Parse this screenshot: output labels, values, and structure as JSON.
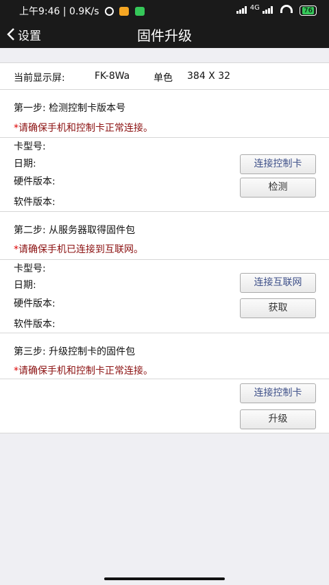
{
  "status_bar": {
    "time_speed": "上午9:46 | 0.9K/s",
    "network": "4G",
    "battery": "76"
  },
  "nav": {
    "back_label": "设置",
    "title": "固件升级"
  },
  "display": {
    "label": "当前显示屏:",
    "model": "FK-8Wa",
    "color_mode": "单色",
    "resolution": "384 X 32"
  },
  "step1": {
    "title": "第一步: 检测控制卡版本号",
    "notice_mark": "*",
    "notice": "请确保手机和控制卡正常连接。",
    "card_model": "卡型号:",
    "date": "日期:",
    "hw_version": "硬件版本:",
    "sw_version": "软件版本:",
    "connect_button": "连接控制卡",
    "detect_button": "检测"
  },
  "step2": {
    "title": "第二步: 从服务器取得固件包",
    "notice_mark": "*",
    "notice": "请确保手机已连接到互联网。",
    "card_model": "卡型号:",
    "date": "日期:",
    "hw_version": "硬件版本:",
    "sw_version": "软件版本:",
    "connect_button": "连接互联网",
    "get_button": "获取"
  },
  "step3": {
    "title": "第三步: 升级控制卡的固件包",
    "notice_mark": "*",
    "notice": "请确保手机和控制卡正常连接。",
    "connect_button": "连接控制卡",
    "upgrade_button": "升级"
  }
}
